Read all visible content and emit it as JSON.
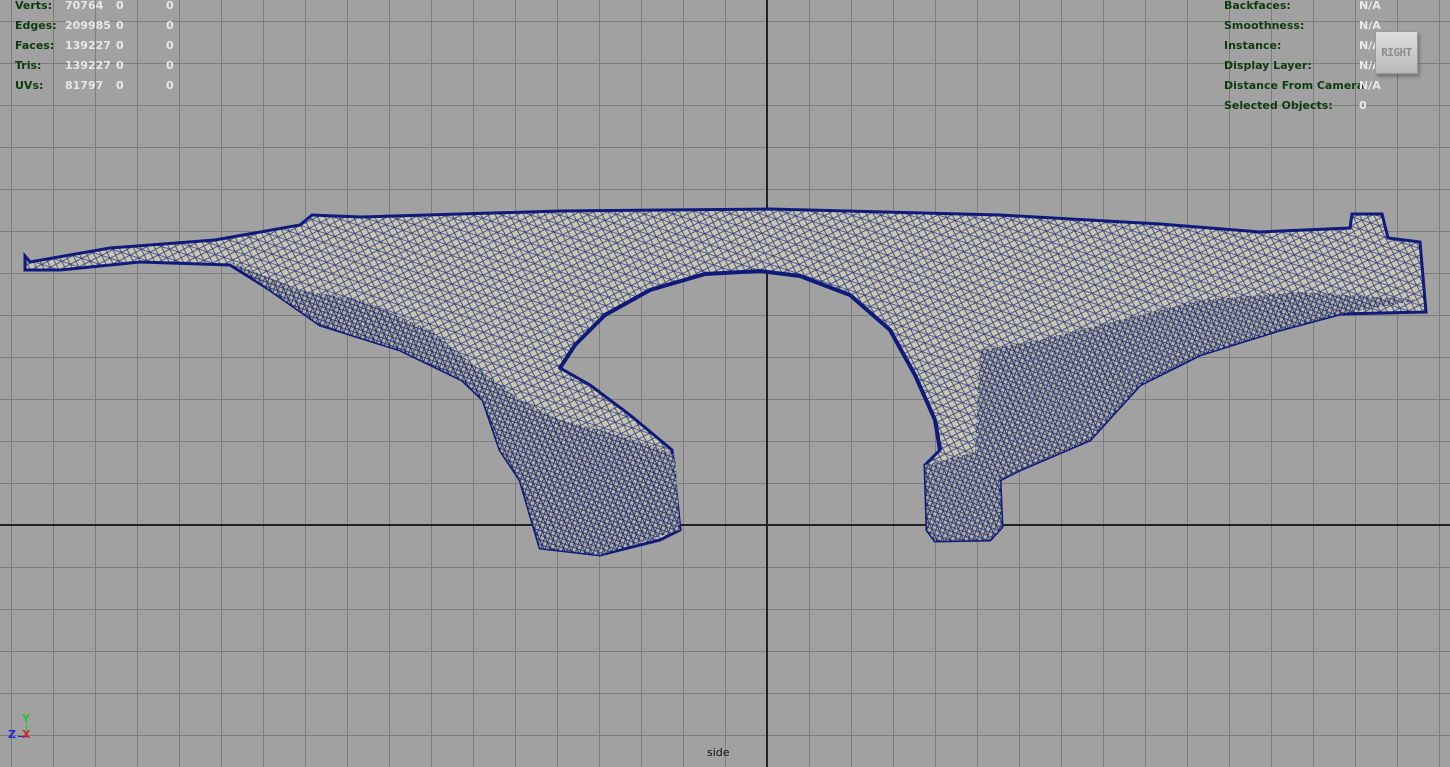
{
  "heads_up_display": {
    "poly_count": [
      {
        "label": "Verts:",
        "values": [
          "70764",
          "0",
          "0"
        ]
      },
      {
        "label": "Edges:",
        "values": [
          "209985",
          "0",
          "0"
        ]
      },
      {
        "label": "Faces:",
        "values": [
          "139227",
          "0",
          "0"
        ]
      },
      {
        "label": "Tris:",
        "values": [
          "139227",
          "0",
          "0"
        ]
      },
      {
        "label": "UVs:",
        "values": [
          "81797",
          "0",
          "0"
        ]
      }
    ],
    "object_details": [
      {
        "label": "Backfaces:",
        "value": "N/A"
      },
      {
        "label": "Smoothness:",
        "value": "N/A"
      },
      {
        "label": "Instance:",
        "value": "N/A"
      },
      {
        "label": "Display Layer:",
        "value": "N/A"
      },
      {
        "label": "Distance From Camera:",
        "value": "N/A"
      },
      {
        "label": "Selected Objects:",
        "value": "0"
      }
    ]
  },
  "view_cube": {
    "label": "RIGHT"
  },
  "camera": {
    "name": "side"
  },
  "axis_gizmo": {
    "y": "Y",
    "z": "Z",
    "x": "X"
  },
  "colors": {
    "viewport_bg": "#a1a1a1",
    "grid": "#7d7d7d",
    "origin_axes": "#232323",
    "wireframe": "#0f1a7a",
    "surface": "#c8c6a8"
  }
}
